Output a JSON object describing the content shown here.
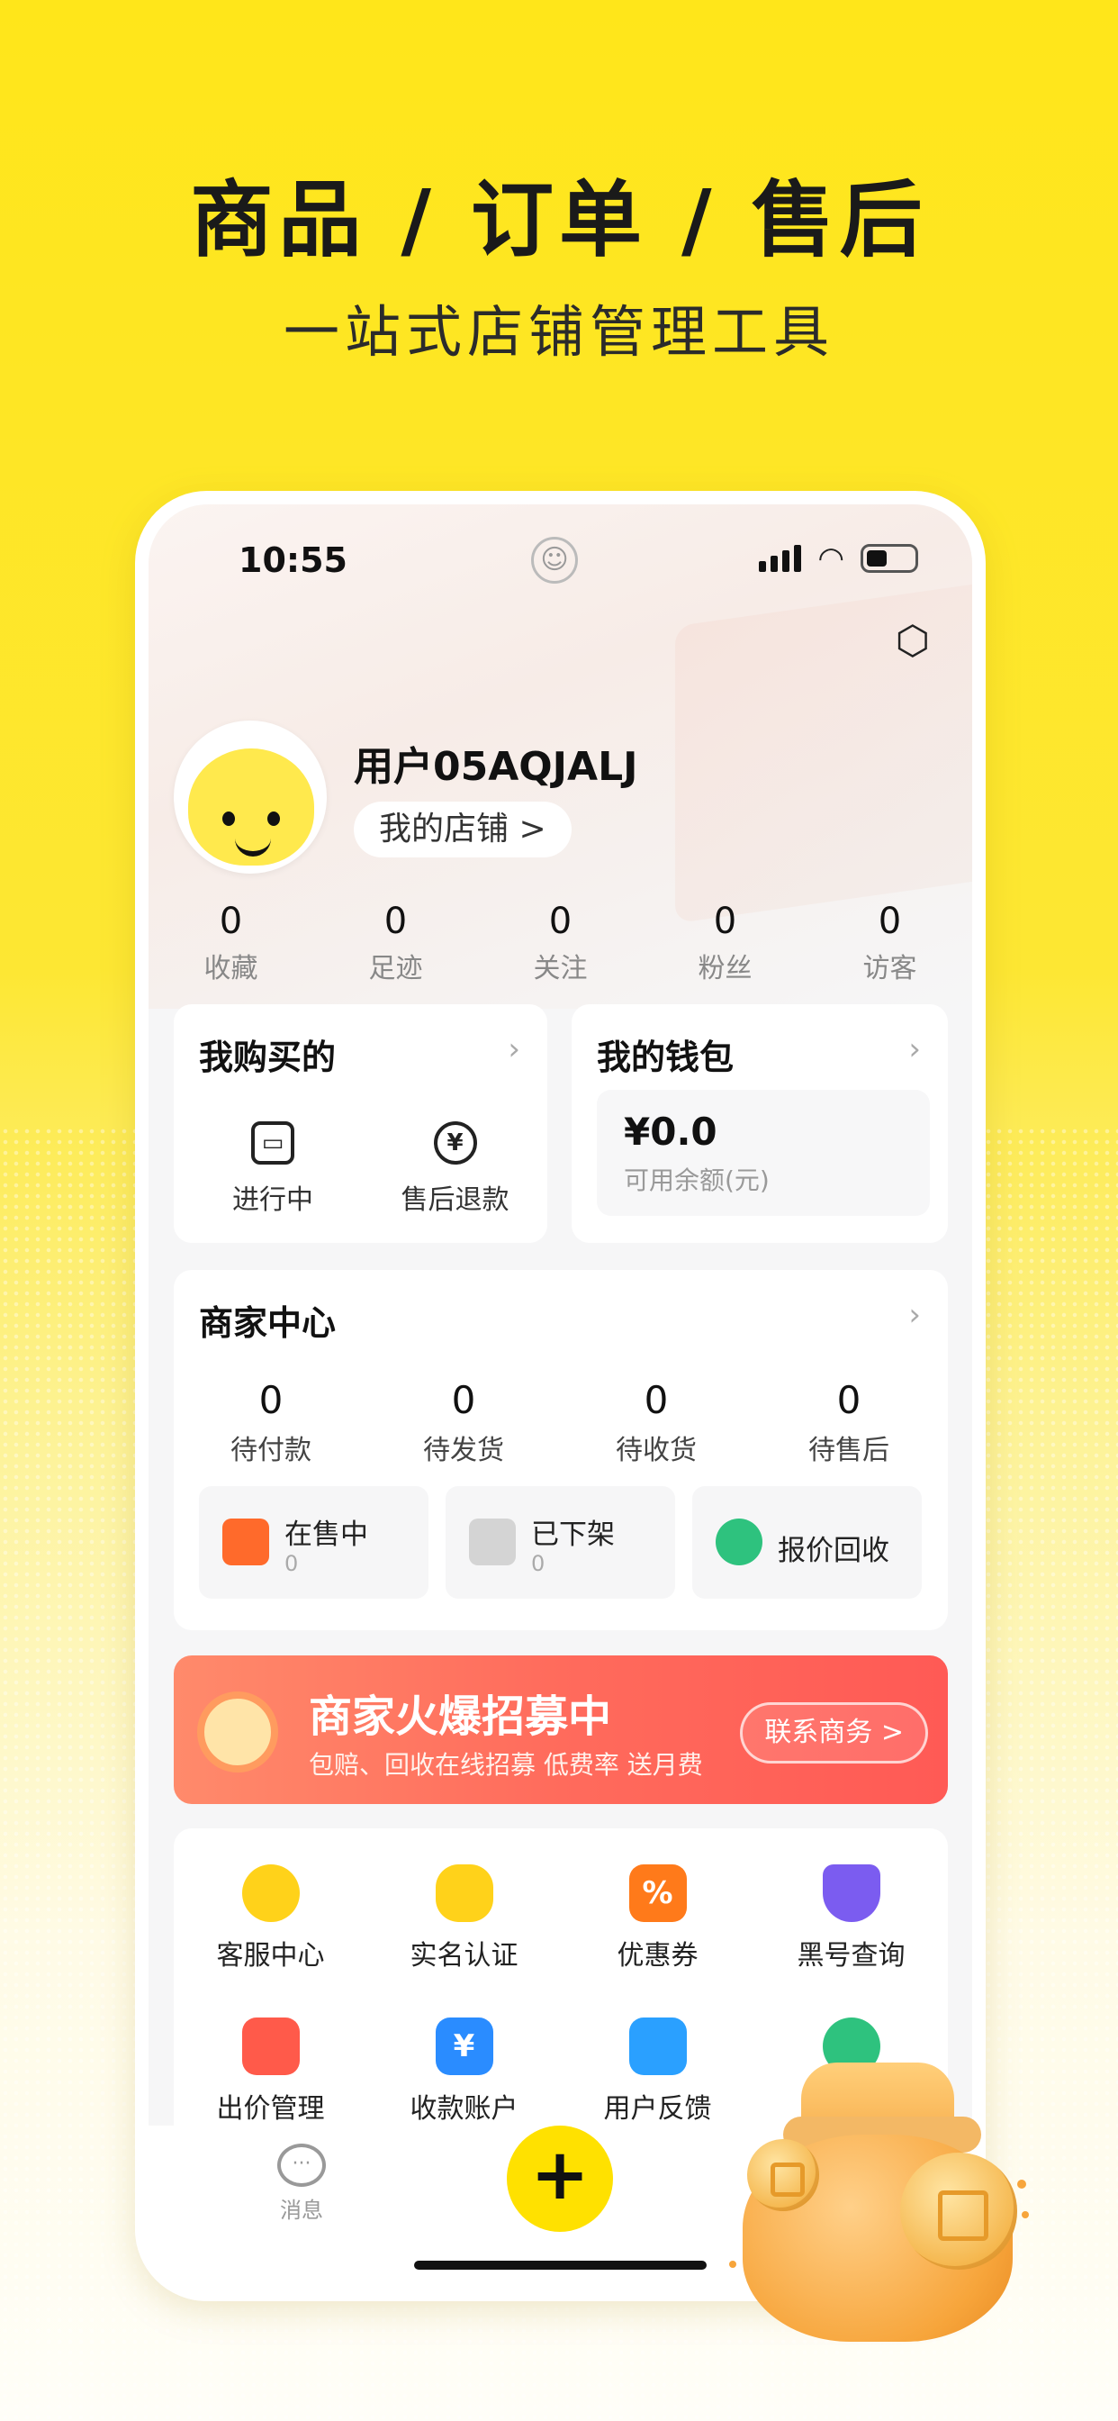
{
  "promo": {
    "headline": "商品 / 订单 / 售后",
    "subline": "一站式店铺管理工具"
  },
  "status_bar": {
    "time": "10:55"
  },
  "profile": {
    "username": "用户05AQJALJ",
    "store_link": "我的店铺 >"
  },
  "stats": [
    {
      "value": "0",
      "label": "收藏"
    },
    {
      "value": "0",
      "label": "足迹"
    },
    {
      "value": "0",
      "label": "关注"
    },
    {
      "value": "0",
      "label": "粉丝"
    },
    {
      "value": "0",
      "label": "访客"
    }
  ],
  "purchases": {
    "title": "我购买的",
    "items": [
      {
        "label": "进行中",
        "icon": "box-icon"
      },
      {
        "label": "售后退款",
        "icon": "yen-refund-icon"
      }
    ]
  },
  "wallet": {
    "title": "我的钱包",
    "amount": "¥0.0",
    "caption": "可用余额(元)"
  },
  "merchant": {
    "title": "商家中心",
    "stats": [
      {
        "value": "0",
        "label": "待付款"
      },
      {
        "value": "0",
        "label": "待发货"
      },
      {
        "value": "0",
        "label": "待收货"
      },
      {
        "value": "0",
        "label": "待售后"
      }
    ],
    "chips": [
      {
        "label": "在售中",
        "count": "0",
        "color": "#ff6a2b"
      },
      {
        "label": "已下架",
        "count": "0",
        "color": "#d4d4d4"
      },
      {
        "label": "报价回收",
        "count": "",
        "color": "#2ec27e"
      }
    ]
  },
  "banner": {
    "title": "商家火爆招募中",
    "subtitle": "包赔、回收在线招募 低费率 送月费",
    "button": "联系商务 >"
  },
  "services": [
    {
      "label": "客服中心",
      "color": "#ffd21a"
    },
    {
      "label": "实名认证",
      "color": "#ffd21a"
    },
    {
      "label": "优惠券",
      "color": "#ff7a1a"
    },
    {
      "label": "黑号查询",
      "color": "#7b5cf0"
    },
    {
      "label": "出价管理",
      "color": "#ff5a4a"
    },
    {
      "label": "收款账户",
      "color": "#2a8cff"
    },
    {
      "label": "用户反馈",
      "color": "#2aa0ff"
    },
    {
      "label": "",
      "color": "#2ec27e"
    }
  ],
  "tabbar": {
    "messages": "消息",
    "plus": "+"
  }
}
